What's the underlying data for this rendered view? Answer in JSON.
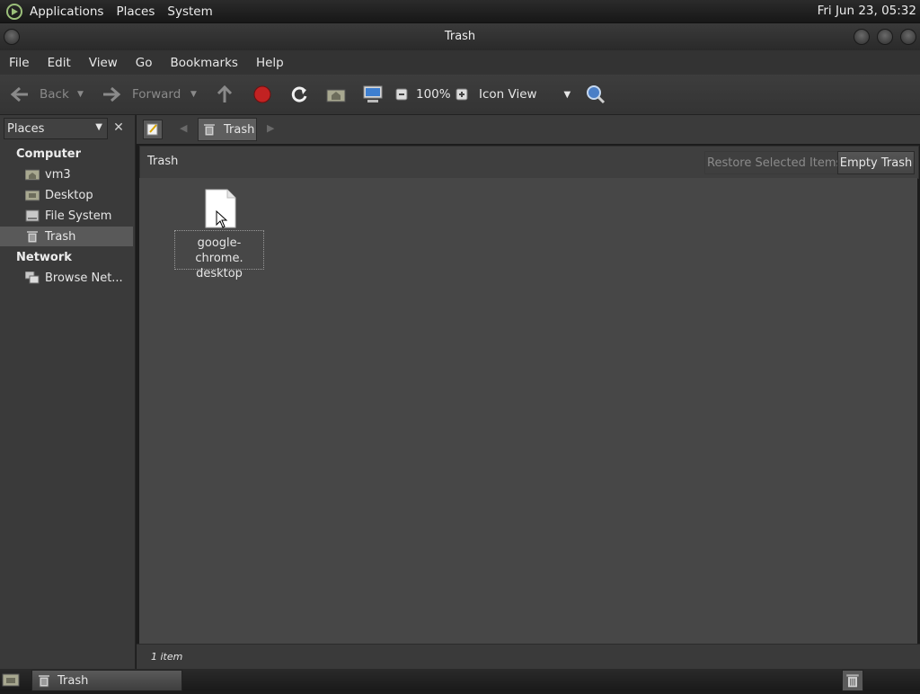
{
  "top_panel": {
    "menus": [
      "Applications",
      "Places",
      "System"
    ],
    "clock": "Fri Jun 23, 05:32"
  },
  "window": {
    "title": "Trash"
  },
  "menubar": [
    "File",
    "Edit",
    "View",
    "Go",
    "Bookmarks",
    "Help"
  ],
  "toolbar": {
    "back": "Back",
    "forward": "Forward",
    "zoom": "100%",
    "view_mode": "Icon View"
  },
  "side_pane": {
    "selector": "Places",
    "sections": [
      {
        "title": "Computer",
        "items": [
          "vm3",
          "Desktop",
          "File System",
          "Trash"
        ]
      },
      {
        "title": "Network",
        "items": [
          "Browse Net..."
        ]
      }
    ],
    "selected": "Trash"
  },
  "location": {
    "crumb": "Trash"
  },
  "infobar": {
    "title": "Trash",
    "restore": "Restore Selected Items",
    "empty": "Empty Trash"
  },
  "files": [
    {
      "line1": "google-chrome.",
      "line2": "desktop"
    }
  ],
  "status": {
    "text": "1 item"
  },
  "taskbar": {
    "task": "Trash"
  },
  "colors": {
    "selection": "#595959",
    "content_bg": "#474747",
    "stop": "#c22222"
  }
}
